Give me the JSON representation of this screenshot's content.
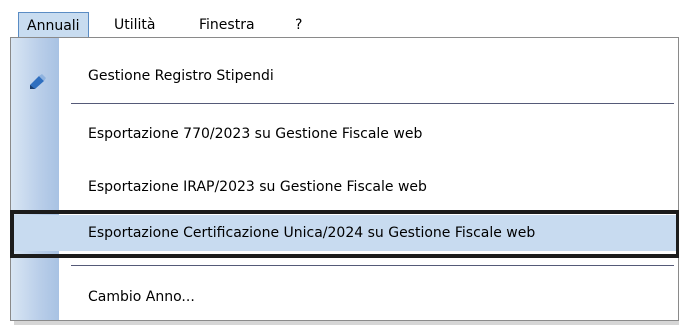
{
  "menubar": {
    "items": [
      {
        "label": "Annuali"
      },
      {
        "label": "Utilità"
      },
      {
        "label": "Finestra"
      },
      {
        "label": "?"
      }
    ]
  },
  "dropdown": {
    "items": [
      {
        "label": "Gestione Registro Stipendi",
        "icon": "register-pencil-icon"
      },
      {
        "label": "Esportazione 770/2023 su Gestione Fiscale web"
      },
      {
        "label": "Esportazione IRAP/2023 su Gestione Fiscale web"
      },
      {
        "label": "Esportazione Certificazione Unica/2024 su Gestione Fiscale web",
        "highlighted": true
      },
      {
        "label": "Cambio Anno..."
      }
    ]
  },
  "colors": {
    "highlight": "#c8dbf0",
    "gutter": "#b9cee9",
    "focus_frame": "#1c1c1c"
  }
}
